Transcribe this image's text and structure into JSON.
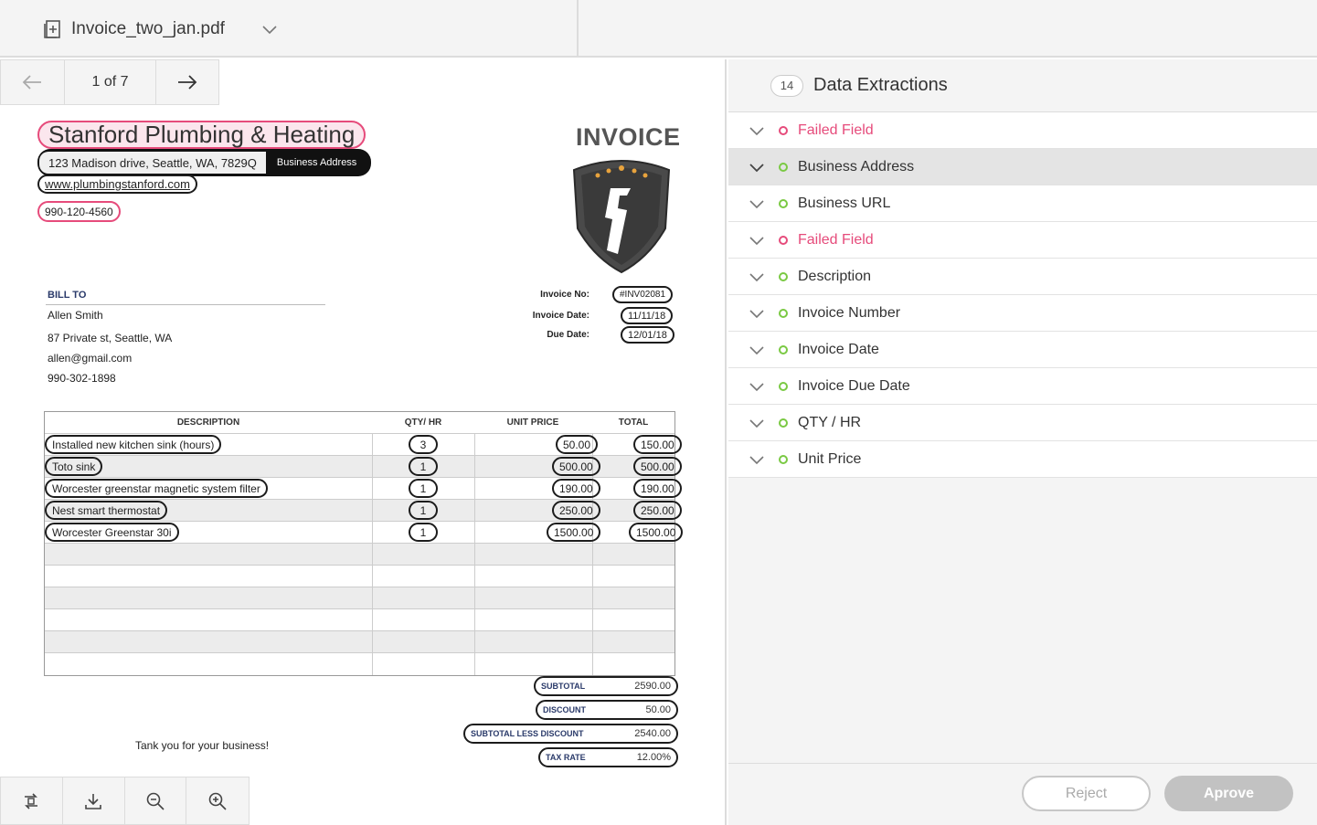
{
  "file": {
    "name": "Invoice_two_jan.pdf"
  },
  "pager": {
    "label": "1 of 7"
  },
  "invoice": {
    "company": "Stanford Plumbing & Heating",
    "address": "123 Madison drive, Seattle, WA, 7829Q",
    "address_tag": "Business Address",
    "url": "www.plumbingstanford.com",
    "phone": "990-120-4560",
    "title": "INVOICE",
    "bill_to": {
      "heading": "BILL TO",
      "name": "Allen Smith",
      "street": "87 Private st, Seattle, WA",
      "email": "allen@gmail.com",
      "phone": "990-302-1898"
    },
    "meta": {
      "number_label": "Invoice No:",
      "number": "#INV02081",
      "date_label": "Invoice Date:",
      "date": "11/11/18",
      "due_label": "Due Date:",
      "due": "12/01/18"
    },
    "columns": {
      "description": "DESCRIPTION",
      "qty": "QTY/ HR",
      "unit_price": "UNIT PRICE",
      "total": "TOTAL"
    },
    "items": [
      {
        "description": "Installed new kitchen sink (hours)",
        "qty": "3",
        "unit_price": "50.00",
        "total": "150.00"
      },
      {
        "description": "Toto sink",
        "qty": "1",
        "unit_price": "500.00",
        "total": "500.00"
      },
      {
        "description": "Worcester greenstar magnetic system filter",
        "qty": "1",
        "unit_price": "190.00",
        "total": "190.00"
      },
      {
        "description": "Nest smart thermostat",
        "qty": "1",
        "unit_price": "250.00",
        "total": "250.00"
      },
      {
        "description": "Worcester Greenstar 30i",
        "qty": "1",
        "unit_price": "1500.00",
        "total": "1500.00"
      }
    ],
    "summary": {
      "subtotal_label": "SUBTOTAL",
      "subtotal": "2590.00",
      "discount_label": "DISCOUNT",
      "discount": "50.00",
      "less_discount_label": "SUBTOTAL LESS DISCOUNT",
      "less_discount": "2540.00",
      "tax_rate_label": "TAX RATE",
      "tax_rate": "12.00%"
    },
    "thanks": "Tank you for your business!"
  },
  "panel": {
    "count": "14",
    "title": "Data Extractions",
    "items": [
      {
        "label": "Failed Field",
        "status": "failed"
      },
      {
        "label": "Business Address",
        "status": "ok",
        "selected": true
      },
      {
        "label": "Business URL",
        "status": "ok"
      },
      {
        "label": "Failed Field",
        "status": "failed"
      },
      {
        "label": "Description",
        "status": "ok"
      },
      {
        "label": "Invoice Number",
        "status": "ok"
      },
      {
        "label": "Invoice Date",
        "status": "ok"
      },
      {
        "label": "Invoice Due Date",
        "status": "ok"
      },
      {
        "label": "QTY / HR",
        "status": "ok"
      },
      {
        "label": "Unit Price",
        "status": "ok"
      }
    ],
    "reject_label": "Reject",
    "approve_label": "Aprove"
  },
  "colors": {
    "ok": "#7ac943",
    "failed": "#e64b7b"
  }
}
